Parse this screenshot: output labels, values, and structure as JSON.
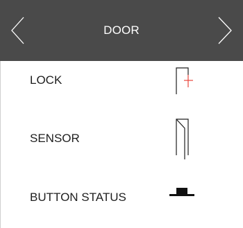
{
  "header": {
    "title": "DOOR",
    "prev_icon": "chevron-left-icon",
    "next_icon": "chevron-right-icon"
  },
  "items": [
    {
      "label": "LOCK",
      "icon": "lock-icon",
      "accent": "#e8463c"
    },
    {
      "label": "SENSOR",
      "icon": "sensor-icon"
    },
    {
      "label": "BUTTON STATUS",
      "icon": "button-status-icon"
    }
  ],
  "colors": {
    "header_bg": "#4a4a4a",
    "header_text": "#ffffff",
    "text": "#1e1e1e",
    "accent": "#e8463c"
  }
}
